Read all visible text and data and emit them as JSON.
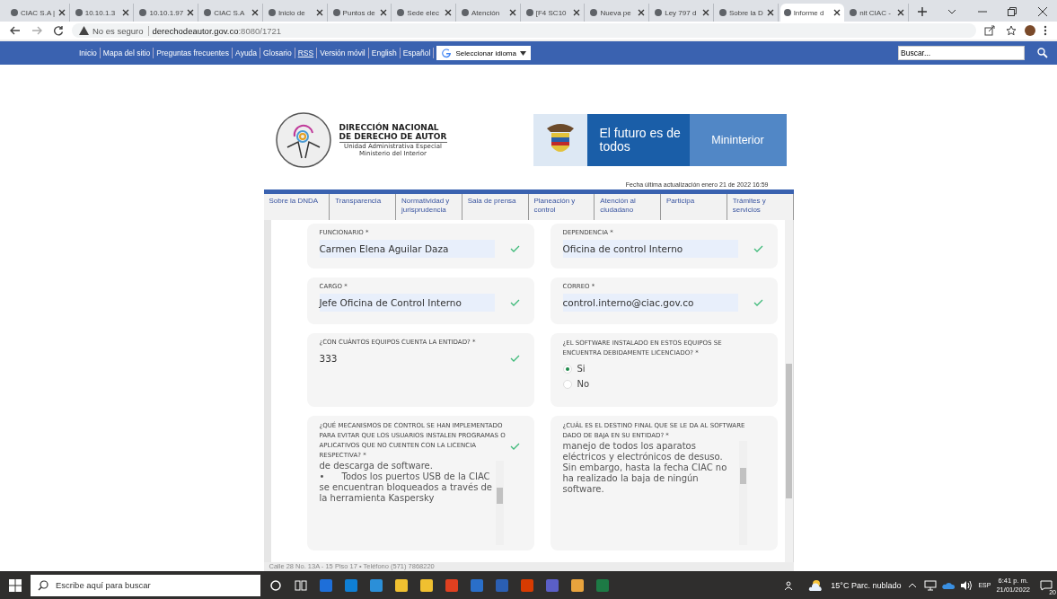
{
  "browser": {
    "tabs": [
      {
        "title": "CIAC S.A |",
        "selected": false
      },
      {
        "title": "10.10.1.3",
        "selected": false
      },
      {
        "title": "10.10.1.97",
        "selected": false
      },
      {
        "title": "CIAC S.A",
        "selected": false
      },
      {
        "title": "Inicio de",
        "selected": false
      },
      {
        "title": "Puntos de",
        "selected": false
      },
      {
        "title": "Sede elec",
        "selected": false
      },
      {
        "title": "Atención",
        "selected": false
      },
      {
        "title": "[F4 SC10",
        "selected": false
      },
      {
        "title": "Nueva pe",
        "selected": false
      },
      {
        "title": "Ley 797 d",
        "selected": false
      },
      {
        "title": "Sobre la D",
        "selected": false
      },
      {
        "title": "Informe d",
        "selected": true
      },
      {
        "title": "nit CIAC -",
        "selected": false
      }
    ],
    "security": "No es seguro",
    "url_host": "derechodeautor.gov.co",
    "url_path": ":8080/1721"
  },
  "site_bar": {
    "links": [
      "Inicio",
      "Mapa del sitio",
      "Preguntas frecuentes",
      "Ayuda",
      "Glosario",
      "RSS",
      "Versión móvil",
      "English",
      "Español"
    ],
    "language_select": "Seleccionar idioma",
    "search_placeholder": "Buscar..."
  },
  "header": {
    "org_title": "DIRECCIÓN NACIONAL DE DERECHO DE AUTOR",
    "org_sub1": "Unidad Administrativa Especial",
    "org_sub2": "Ministerio del Interior",
    "slogan": "El futuro es de todos",
    "ministry": "Mininterior",
    "updated": "Fecha última actualización enero 21 de 2022 16:59"
  },
  "nav": [
    "Sobre la DNDA",
    "Transparencia",
    "Normatividad y jurisprudencia",
    "Sala de prensa",
    "Planeación y control",
    "Atención al ciudadano",
    "Participa",
    "Trámites y servicios"
  ],
  "form": [
    {
      "kind": "text",
      "label": "FUNCIONARIO *",
      "value": "Carmen Elena Aguilar Daza",
      "valid": true
    },
    {
      "kind": "text",
      "label": "DEPENDENCIA *",
      "value": "Oficina de control Interno",
      "valid": true
    },
    {
      "kind": "text",
      "label": "CARGO *",
      "value": "Jefe Oficina de Control Interno",
      "valid": true
    },
    {
      "kind": "text",
      "label": "CORREO *",
      "value": "control.interno@ciac.gov.co",
      "valid": true
    },
    {
      "kind": "number",
      "label": "¿CON CUÁNTOS EQUIPOS CUENTA LA ENTIDAD? *",
      "value": "333",
      "valid": true
    },
    {
      "kind": "radio",
      "label": "¿EL SOFTWARE INSTALADO EN ESTOS EQUIPOS SE ENCUENTRA DEBIDAMENTE LICENCIADO? *",
      "valid": false,
      "options": [
        {
          "label": "Si",
          "selected": true
        },
        {
          "label": "No",
          "selected": false
        }
      ]
    },
    {
      "kind": "textarea",
      "label": "¿QUÉ MECANISMOS DE CONTROL SE HAN IMPLEMENTADO PARA EVITAR QUE LOS USUARIOS INSTALEN PROGRAMAS O APLICATIVOS QUE NO CUENTEN CON LA LICENCIA RESPECTIVA? *",
      "value": "de descarga de software.\n•      Todos los puertos USB de la CIAC se encuentran bloqueados a través de la herramienta Kaspersky",
      "valid": true
    },
    {
      "kind": "textarea",
      "label": "¿CUÁL ES EL DESTINO FINAL QUE SE LE DA AL SOFTWARE DADO DE BAJA EN SU ENTIDAD? *",
      "value": "manejo de todos los aparatos eléctricos y electrónicos de desuso. Sin embargo, hasta la fecha CIAC no ha realizado la baja de ningún software.",
      "valid": false
    }
  ],
  "footer": "Calle 28 No. 13A - 15 Piso 17 • Teléfono (571) 7868220",
  "taskbar": {
    "search_placeholder": "Escribe aquí para buscar",
    "weather": "15°C Parc. nublado",
    "language": "ESP",
    "time": "6:41 p. m.",
    "date": "21/01/2022",
    "notifications": "20"
  }
}
